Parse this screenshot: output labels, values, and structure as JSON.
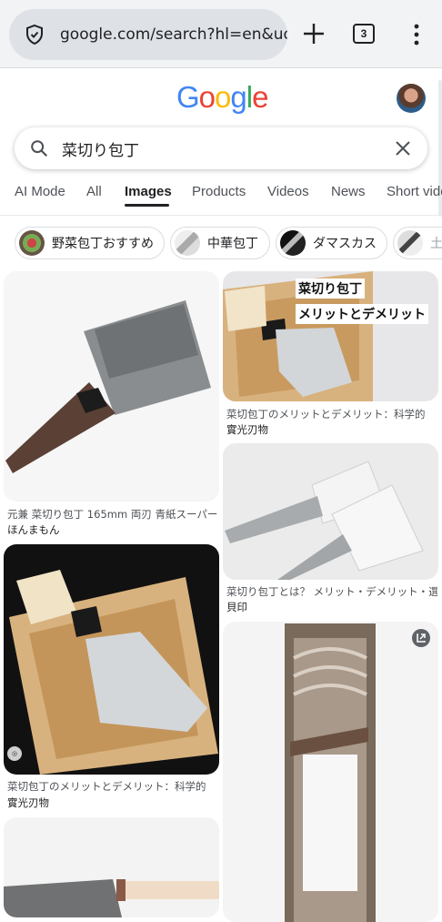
{
  "browser": {
    "url": "google.com/search?hl=en&udm",
    "tab_count": "3"
  },
  "logo": {
    "letters": [
      "G",
      "o",
      "o",
      "g",
      "l",
      "e"
    ],
    "colors": [
      "#4285F4",
      "#EA4335",
      "#FBBC05",
      "#4285F4",
      "#34A853",
      "#EA4335"
    ]
  },
  "search": {
    "query": "菜切り包丁"
  },
  "tabs": [
    {
      "label": "AI Mode"
    },
    {
      "label": "All"
    },
    {
      "label": "Images"
    },
    {
      "label": "Products"
    },
    {
      "label": "Videos"
    },
    {
      "label": "News"
    },
    {
      "label": "Short vide"
    }
  ],
  "active_tab": "Images",
  "chips": [
    {
      "label": "野菜包丁おすすめ"
    },
    {
      "label": "中華包丁"
    },
    {
      "label": "ダマスカス"
    },
    {
      "label": "土"
    }
  ],
  "results": [
    {
      "title": "元兼 菜切り包丁 165mm 両刃 青紙スーパー",
      "source": "ほんまもん"
    },
    {
      "title": "菜切包丁のメリットとデメリット：科学的",
      "source": "實光刃物",
      "overlay": [
        "菜切り包丁",
        "メリットとデメリット"
      ]
    },
    {
      "title": "菜切り包丁とは？ メリット・デメリット・選",
      "source": "貝印"
    },
    {
      "title": "菜切包丁のメリットとデメリット：科学的",
      "source": "實光刃物"
    }
  ]
}
